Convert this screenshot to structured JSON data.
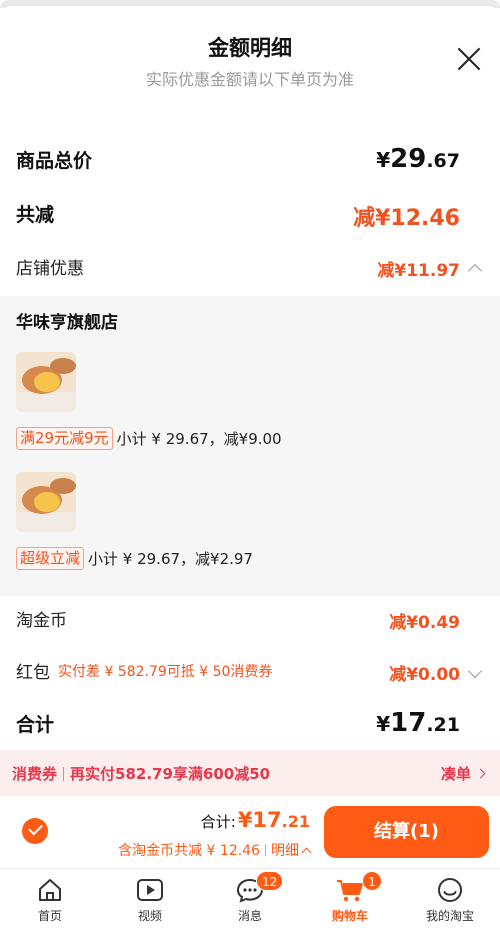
{
  "header": {
    "title": "金额明细",
    "subtitle": "实际优惠金额请以下单页为准"
  },
  "summary": {
    "goods_total_label": "商品总价",
    "goods_total_symbol": "¥",
    "goods_total_int": "29",
    "goods_total_dec": ".67",
    "total_discount_label": "共减",
    "total_discount_value": "减¥12.46",
    "store_discount_label": "店铺优惠",
    "store_discount_value": "减¥11.97"
  },
  "store": {
    "name": "华味亨旗舰店",
    "items": [
      {
        "tag": "满29元减9元",
        "detail": "小计 ¥ 29.67，减¥9.00"
      },
      {
        "tag": "超级立减",
        "detail": "小计 ¥ 29.67，减¥2.97"
      }
    ]
  },
  "extras": {
    "taojinbi_label": "淘金币",
    "taojinbi_value": "减¥0.49",
    "hongbao_label": "红包",
    "hongbao_hint": "实付差 ¥ 582.79可抵 ¥ 50消费券",
    "hongbao_value": "减¥0.00",
    "total_label": "合计",
    "total_symbol": "¥",
    "total_int": "17",
    "total_dec": ".21"
  },
  "coupon": {
    "left_label": "消费券",
    "left_text": "再实付582.79享满600减50",
    "right_label": "凑单"
  },
  "bottom": {
    "total_label": "合计:",
    "total_value_int": "¥17",
    "total_value_dec": ".21",
    "sub_text": "含淘金币共减 ¥ 12.46",
    "detail_label": "明细",
    "checkout_label": "结算(1)"
  },
  "tabs": [
    {
      "label": "首页",
      "icon": "home-icon"
    },
    {
      "label": "视频",
      "icon": "video-icon"
    },
    {
      "label": "消息",
      "icon": "message-icon",
      "badge": "12"
    },
    {
      "label": "购物车",
      "icon": "cart-icon",
      "badge": "1",
      "active": true
    },
    {
      "label": "我的淘宝",
      "icon": "profile-icon"
    }
  ],
  "colors": {
    "accent": "#ff5b15",
    "discount_red": "#f2521f",
    "coupon_red": "#e8374c",
    "coupon_bg": "#fdeeee"
  }
}
